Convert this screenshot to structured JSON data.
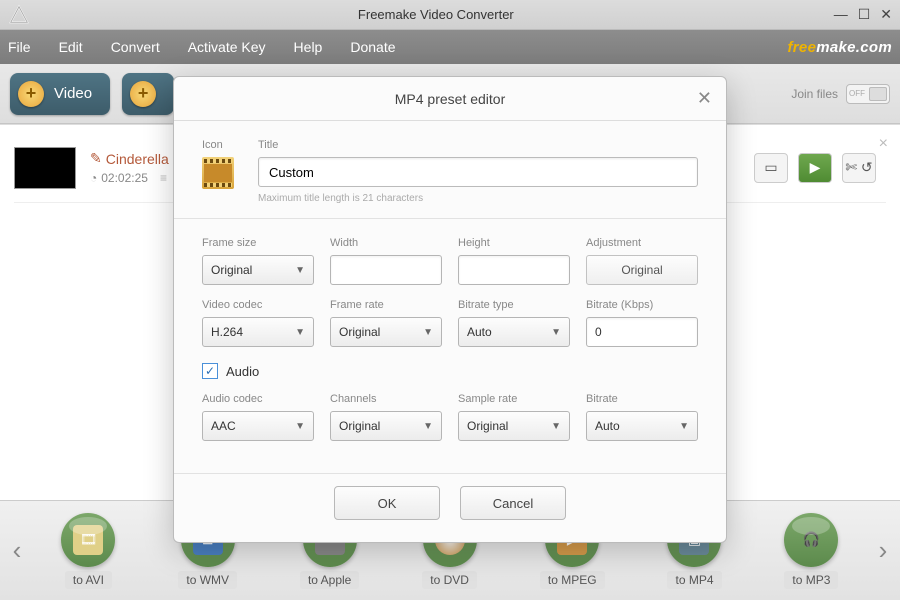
{
  "app": {
    "title": "Freemake Video Converter",
    "brand_free": "free",
    "brand_make": "make.com"
  },
  "menu": {
    "file": "File",
    "edit": "Edit",
    "convert": "Convert",
    "activate": "Activate Key",
    "help": "Help",
    "donate": "Donate"
  },
  "toolbar": {
    "video": "Video",
    "join_files": "Join files",
    "join_state": "OFF"
  },
  "file": {
    "title": "Cinderella",
    "duration": "02:02:25"
  },
  "formats": {
    "avi": "to AVI",
    "wmv": "to WMV",
    "apple": "to Apple",
    "dvd": "to DVD",
    "mpeg": "to MPEG",
    "mp4": "to MP4",
    "mp3": "to MP3"
  },
  "modal": {
    "title": "MP4 preset editor",
    "icon_label": "Icon",
    "title_label": "Title",
    "title_value": "Custom",
    "title_hint": "Maximum title length is 21 characters",
    "frame_size_label": "Frame size",
    "frame_size_value": "Original",
    "width_label": "Width",
    "width_value": "",
    "height_label": "Height",
    "height_value": "",
    "adjustment_label": "Adjustment",
    "adjustment_value": "Original",
    "video_codec_label": "Video codec",
    "video_codec_value": "H.264",
    "frame_rate_label": "Frame rate",
    "frame_rate_value": "Original",
    "bitrate_type_label": "Bitrate type",
    "bitrate_type_value": "Auto",
    "bitrate_kbps_label": "Bitrate (Kbps)",
    "bitrate_kbps_value": "0",
    "audio_check": "Audio",
    "audio_codec_label": "Audio codec",
    "audio_codec_value": "AAC",
    "channels_label": "Channels",
    "channels_value": "Original",
    "sample_rate_label": "Sample rate",
    "sample_rate_value": "Original",
    "audio_bitrate_label": "Bitrate",
    "audio_bitrate_value": "Auto",
    "ok": "OK",
    "cancel": "Cancel"
  }
}
